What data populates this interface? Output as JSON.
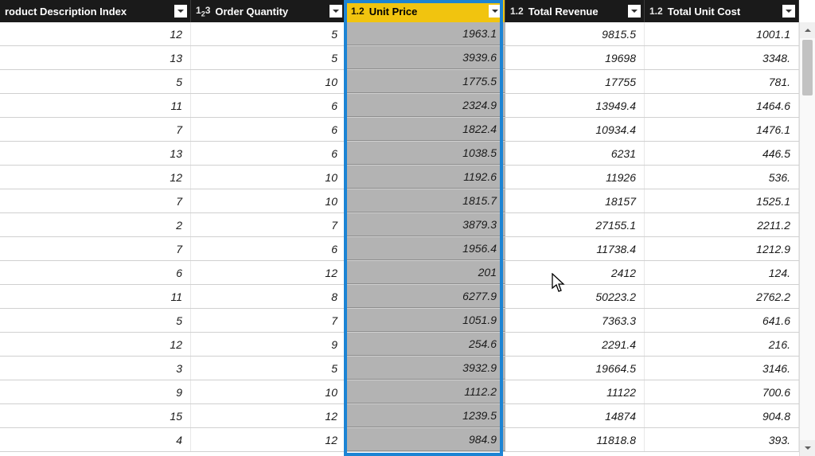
{
  "columns": [
    {
      "type_prefix": "",
      "label": "roduct Description Index",
      "selected": false,
      "width_class": "col0"
    },
    {
      "type_prefix": "int",
      "label": "Order Quantity",
      "selected": false,
      "width_class": "col1"
    },
    {
      "type_prefix": "dec",
      "label": "Unit Price",
      "selected": true,
      "width_class": "col2"
    },
    {
      "type_prefix": "dec",
      "label": "Total Revenue",
      "selected": false,
      "width_class": "col3"
    },
    {
      "type_prefix": "dec",
      "label": "Total Unit Cost",
      "selected": false,
      "width_class": "col4"
    }
  ],
  "type_labels": {
    "int": "1²3",
    "dec": "1.2"
  },
  "rows": [
    [
      "12",
      "5",
      "1963.1",
      "9815.5",
      "1001.1"
    ],
    [
      "13",
      "5",
      "3939.6",
      "19698",
      "3348."
    ],
    [
      "5",
      "10",
      "1775.5",
      "17755",
      "781."
    ],
    [
      "11",
      "6",
      "2324.9",
      "13949.4",
      "1464.6"
    ],
    [
      "7",
      "6",
      "1822.4",
      "10934.4",
      "1476.1"
    ],
    [
      "13",
      "6",
      "1038.5",
      "6231",
      "446.5"
    ],
    [
      "12",
      "10",
      "1192.6",
      "11926",
      "536."
    ],
    [
      "7",
      "10",
      "1815.7",
      "18157",
      "1525.1"
    ],
    [
      "2",
      "7",
      "3879.3",
      "27155.1",
      "2211.2"
    ],
    [
      "7",
      "6",
      "1956.4",
      "11738.4",
      "1212.9"
    ],
    [
      "6",
      "12",
      "201",
      "2412",
      "124."
    ],
    [
      "11",
      "8",
      "6277.9",
      "50223.2",
      "2762.2"
    ],
    [
      "5",
      "7",
      "1051.9",
      "7363.3",
      "641.6"
    ],
    [
      "12",
      "9",
      "254.6",
      "2291.4",
      "216."
    ],
    [
      "3",
      "5",
      "3932.9",
      "19664.5",
      "3146."
    ],
    [
      "9",
      "10",
      "1112.2",
      "11122",
      "700.6"
    ],
    [
      "15",
      "12",
      "1239.5",
      "14874",
      "904.8"
    ],
    [
      "4",
      "12",
      "984.9",
      "11818.8",
      "393."
    ]
  ]
}
